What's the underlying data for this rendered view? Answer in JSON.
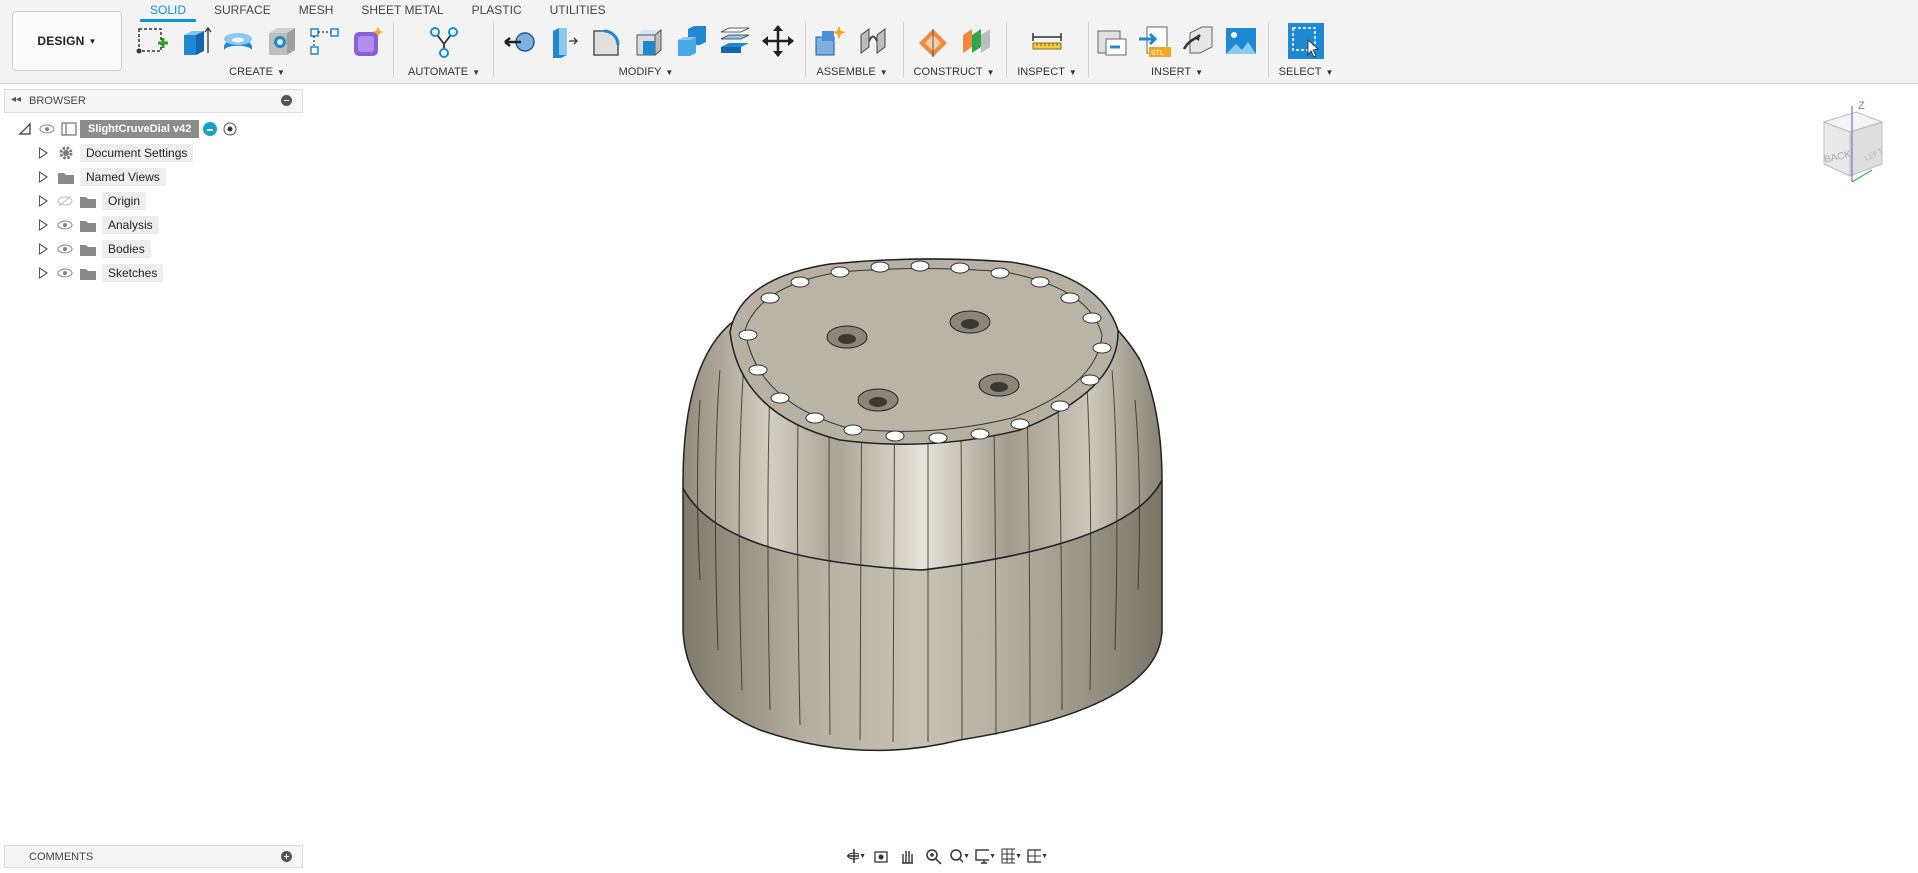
{
  "app": {
    "workspace_label": "DESIGN"
  },
  "tabs": [
    {
      "label": "SOLID",
      "active": true
    },
    {
      "label": "SURFACE",
      "active": false
    },
    {
      "label": "MESH",
      "active": false
    },
    {
      "label": "SHEET METAL",
      "active": false
    },
    {
      "label": "PLASTIC",
      "active": false
    },
    {
      "label": "UTILITIES",
      "active": false
    }
  ],
  "groups": {
    "create": "CREATE",
    "automate": "AUTOMATE",
    "modify": "MODIFY",
    "assemble": "ASSEMBLE",
    "construct": "CONSTRUCT",
    "inspect": "INSPECT",
    "insert": "INSERT",
    "select": "SELECT"
  },
  "browser": {
    "title": "BROWSER",
    "root": "SlightCruveDial v42",
    "items": [
      {
        "label": "Document Settings",
        "icon": "gear-icon"
      },
      {
        "label": "Named Views",
        "icon": "folder-icon"
      },
      {
        "label": "Origin",
        "icon": "folder-icon"
      },
      {
        "label": "Analysis",
        "icon": "folder-icon"
      },
      {
        "label": "Bodies",
        "icon": "folder-icon"
      },
      {
        "label": "Sketches",
        "icon": "folder-icon"
      }
    ]
  },
  "comments": {
    "title": "COMMENTS"
  },
  "viewcube": {
    "face_back": "BACK",
    "face_left": "LEFT",
    "axis_z": "Z"
  },
  "colors": {
    "accent": "#0696d7",
    "model": "#b9b4a6"
  }
}
